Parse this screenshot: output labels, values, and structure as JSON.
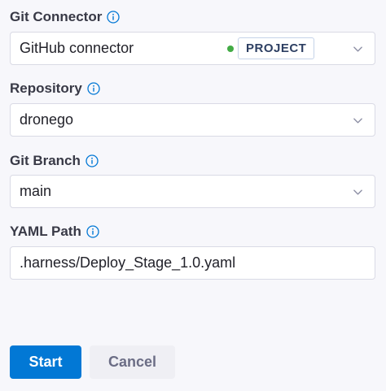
{
  "fields": [
    {
      "label": "Git Connector",
      "value": "GitHub connector",
      "status": "connected",
      "badge": "PROJECT",
      "type": "select"
    },
    {
      "label": "Repository",
      "value": "dronego",
      "type": "select"
    },
    {
      "label": "Git Branch",
      "value": "main",
      "type": "select"
    },
    {
      "label": "YAML Path",
      "value": ".harness/Deploy_Stage_1.0.yaml",
      "type": "text"
    }
  ],
  "actions": {
    "start_label": "Start",
    "cancel_label": "Cancel"
  },
  "colors": {
    "primary": "#0278d5",
    "status_connected": "#42ab45",
    "info_icon": "#0278d5",
    "label": "#383946"
  },
  "icons": {
    "info": "info-circle-icon",
    "dropdown": "chevron-down-icon",
    "status": "status-dot"
  }
}
